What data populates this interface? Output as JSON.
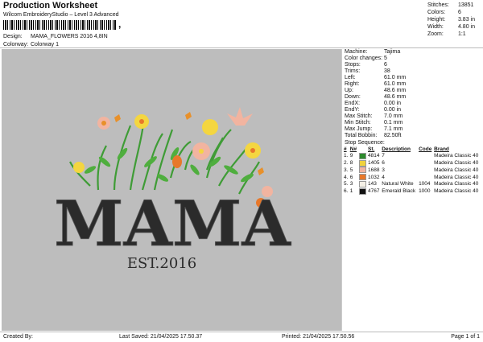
{
  "header": {
    "title": "Production Worksheet",
    "subtitle": "Wilcom EmbroideryStudio – Level 3 Advanced",
    "barcode_tail": ",",
    "design_label": "Design:",
    "design_value": "MAMA_FLOWERS 2016 4,8IN",
    "colorway_label": "Colorway:",
    "colorway_value": "Colorway 1"
  },
  "summary": [
    {
      "k": "Stitches:",
      "v": "13851"
    },
    {
      "k": "Colors:",
      "v": "6"
    },
    {
      "k": "Height:",
      "v": "3.83 in"
    },
    {
      "k": "Width:",
      "v": "4.80 in"
    },
    {
      "k": "Zoom:",
      "v": "1:1"
    }
  ],
  "design": {
    "word": "MAMA",
    "est": "EST.2016"
  },
  "machine_info": [
    {
      "k": "Machine:",
      "v": "Tajima"
    },
    {
      "k": "Color changes:",
      "v": "5"
    },
    {
      "k": "Stops:",
      "v": "6"
    },
    {
      "k": "Trims:",
      "v": "38"
    },
    {
      "k": "Left:",
      "v": "61.0 mm"
    },
    {
      "k": "Right:",
      "v": "61.0 mm"
    },
    {
      "k": "Up:",
      "v": "48.6 mm"
    },
    {
      "k": "Down:",
      "v": "48.6 mm"
    },
    {
      "k": "EndX:",
      "v": "0.00 in"
    },
    {
      "k": "EndY:",
      "v": "0.00 in"
    },
    {
      "k": "Max Stitch:",
      "v": "7.0 mm"
    },
    {
      "k": "Min Stitch:",
      "v": "0.1 mm"
    },
    {
      "k": "Max Jump:",
      "v": "7.1 mm"
    },
    {
      "k": "Total Bobbin:",
      "v": "82.50ft"
    }
  ],
  "stop_sequence": {
    "heading": "Stop Sequence:",
    "columns": [
      "#",
      "N#",
      "",
      "St.",
      "Description",
      "Code",
      "Brand"
    ],
    "rows": [
      {
        "n": "1.",
        "num": "9",
        "color": "#2e8b2e",
        "st": "4814",
        "desc": "7",
        "code": "",
        "brand": "Madeira Classic 40"
      },
      {
        "n": "2.",
        "num": "8",
        "color": "#f0d23c",
        "st": "1405",
        "desc": "6",
        "code": "",
        "brand": "Madeira Classic 40"
      },
      {
        "n": "3.",
        "num": "5",
        "color": "#f2b4a0",
        "st": "1688",
        "desc": "3",
        "code": "",
        "brand": "Madeira Classic 40"
      },
      {
        "n": "4.",
        "num": "6",
        "color": "#e8782a",
        "st": "1032",
        "desc": "4",
        "code": "",
        "brand": "Madeira Classic 40"
      },
      {
        "n": "5.",
        "num": "3",
        "color": "#f4f0e6",
        "st": "143",
        "desc": "Natural White",
        "code": "1004",
        "brand": "Madeira Classic 40"
      },
      {
        "n": "6.",
        "num": "1",
        "color": "#111111",
        "st": "4767",
        "desc": "Emerald Black",
        "code": "1000",
        "brand": "Madeira Classic 40"
      }
    ]
  },
  "footer": {
    "created_by": "Created By:",
    "last_saved": "Last Saved: 21/04/2025 17.50.37",
    "printed": "Printed: 21/04/2025 17.50.56",
    "page": "Page 1 of 1"
  }
}
